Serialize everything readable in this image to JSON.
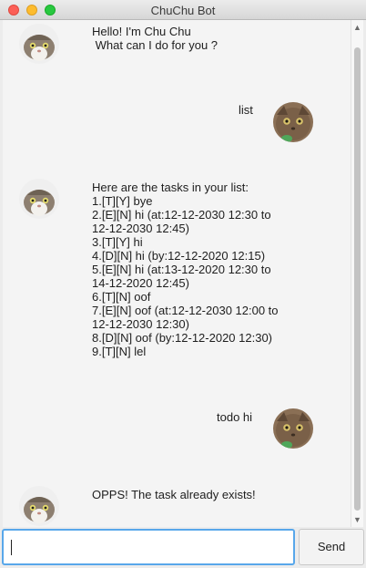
{
  "window": {
    "title": "ChuChu Bot"
  },
  "messages": [
    {
      "sender": "bot",
      "text": "Hello! I'm Chu Chu\n What can I do for you ?"
    },
    {
      "sender": "user",
      "text": "list"
    },
    {
      "sender": "bot",
      "text": "Here are the tasks in your list:\n1.[T][Y] bye\n2.[E][N] hi (at:12-12-2030 12:30 to\n12-12-2030 12:45)\n3.[T][Y] hi\n4.[D][N] hi (by:12-12-2020 12:15)\n5.[E][N] hi (at:13-12-2020 12:30 to\n14-12-2020 12:45)\n6.[T][N] oof\n7.[E][N] oof (at:12-12-2030 12:00 to\n12-12-2030 12:30)\n8.[D][N] oof (by:12-12-2020 12:30)\n9.[T][N] lel"
    },
    {
      "sender": "user",
      "text": "todo hi"
    },
    {
      "sender": "bot",
      "text": "OPPS! The task already exists!"
    }
  ],
  "input": {
    "value": ""
  },
  "send_label": "Send"
}
